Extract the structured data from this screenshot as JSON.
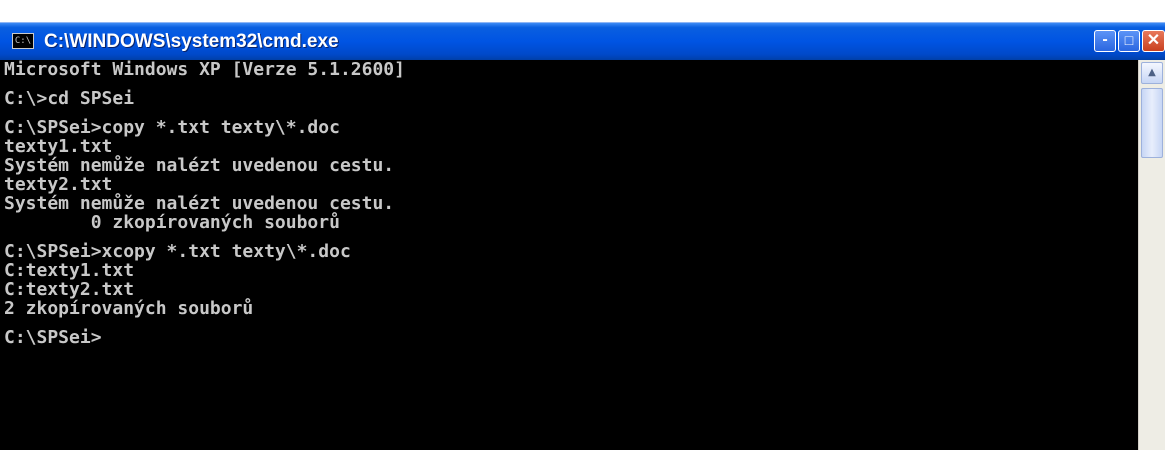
{
  "window": {
    "title": "C:\\WINDOWS\\system32\\cmd.exe",
    "icon_label": "C:\\",
    "buttons": {
      "minimize": "-",
      "maximize": "□",
      "close": "✕"
    }
  },
  "console": {
    "lines": [
      "Microsoft Windows XP [Verze 5.1.2600]",
      "",
      "C:\\>cd SPSei",
      "",
      "C:\\SPSei>copy *.txt texty\\*.doc",
      "texty1.txt",
      "Systém nemůže nalézt uvedenou cestu.",
      "texty2.txt",
      "Systém nemůže nalézt uvedenou cestu.",
      "        0 zkopírovaných souborů",
      "",
      "C:\\SPSei>xcopy *.txt texty\\*.doc",
      "C:texty1.txt",
      "C:texty2.txt",
      "2 zkopírovaných souborů",
      "",
      "C:\\SPSei>"
    ]
  },
  "scrollbar": {
    "up_arrow": "▲"
  },
  "colors": {
    "titlebar": "#0054e3",
    "console_bg": "#000000",
    "console_text": "#c8c8c8",
    "close_button": "#c9401f"
  }
}
